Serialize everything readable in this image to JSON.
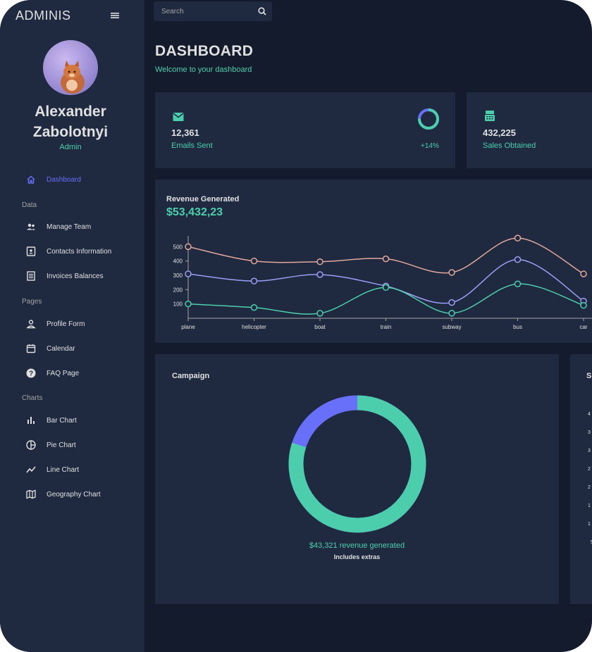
{
  "brand": "ADMINIS",
  "user": {
    "name_line1": "Alexander",
    "name_line2": "Zabolotnyi",
    "role": "Admin"
  },
  "sidebar": {
    "items": [
      {
        "label": "Dashboard",
        "icon": "home-icon",
        "active": true
      },
      {
        "label": "Manage Team",
        "icon": "team-icon"
      },
      {
        "label": "Contacts Information",
        "icon": "contacts-icon"
      },
      {
        "label": "Invoices Balances",
        "icon": "receipt-icon"
      },
      {
        "label": "Profile Form",
        "icon": "person-icon"
      },
      {
        "label": "Calendar",
        "icon": "calendar-icon"
      },
      {
        "label": "FAQ Page",
        "icon": "help-icon"
      },
      {
        "label": "Bar Chart",
        "icon": "bar-chart-icon"
      },
      {
        "label": "Pie Chart",
        "icon": "pie-chart-icon"
      },
      {
        "label": "Line Chart",
        "icon": "line-chart-icon"
      },
      {
        "label": "Geography Chart",
        "icon": "map-icon"
      }
    ],
    "sections": [
      "Data",
      "Pages",
      "Charts"
    ]
  },
  "search": {
    "placeholder": "Search"
  },
  "header": {
    "title": "DASHBOARD",
    "subtitle": "Welcome to your dashboard"
  },
  "stats": [
    {
      "value": "12,361",
      "label": "Emails Sent",
      "change": "+14%",
      "icon": "email-icon",
      "progress": 0.75
    },
    {
      "value": "432,225",
      "label": "Sales Obtained",
      "icon": "point-of-sale-icon"
    }
  ],
  "revenue": {
    "title": "Revenue Generated",
    "value": "$53,432,23"
  },
  "campaign": {
    "title": "Campaign",
    "text": "$43,321 revenue generated",
    "subtext": "Includes extras",
    "progress": 0.8
  },
  "partial_card": {
    "title_fragment": "S",
    "tick_fragments": [
      "4",
      "3",
      "3",
      "2",
      "2",
      "1",
      "1",
      "5"
    ]
  },
  "colors": {
    "accent_green": "#4cceac",
    "accent_blue": "#6870fa",
    "series_salmon": "#e2a79b",
    "series_purple": "#9a9ef5",
    "series_green": "#4cceac"
  },
  "chart_data": {
    "type": "line",
    "categories": [
      "plane",
      "helicopter",
      "boat",
      "train",
      "subway",
      "bus",
      "car"
    ],
    "y_ticks": [
      100,
      200,
      300,
      400,
      500
    ],
    "ylim": [
      0,
      560
    ],
    "grid": false,
    "series": [
      {
        "color": "#e2a79b",
        "values": [
          500,
          400,
          395,
          415,
          320,
          560,
          310
        ]
      },
      {
        "color": "#9a9ef5",
        "values": [
          310,
          260,
          305,
          225,
          110,
          410,
          120
        ]
      },
      {
        "color": "#4cceac",
        "values": [
          100,
          75,
          35,
          215,
          35,
          240,
          90
        ]
      }
    ]
  }
}
